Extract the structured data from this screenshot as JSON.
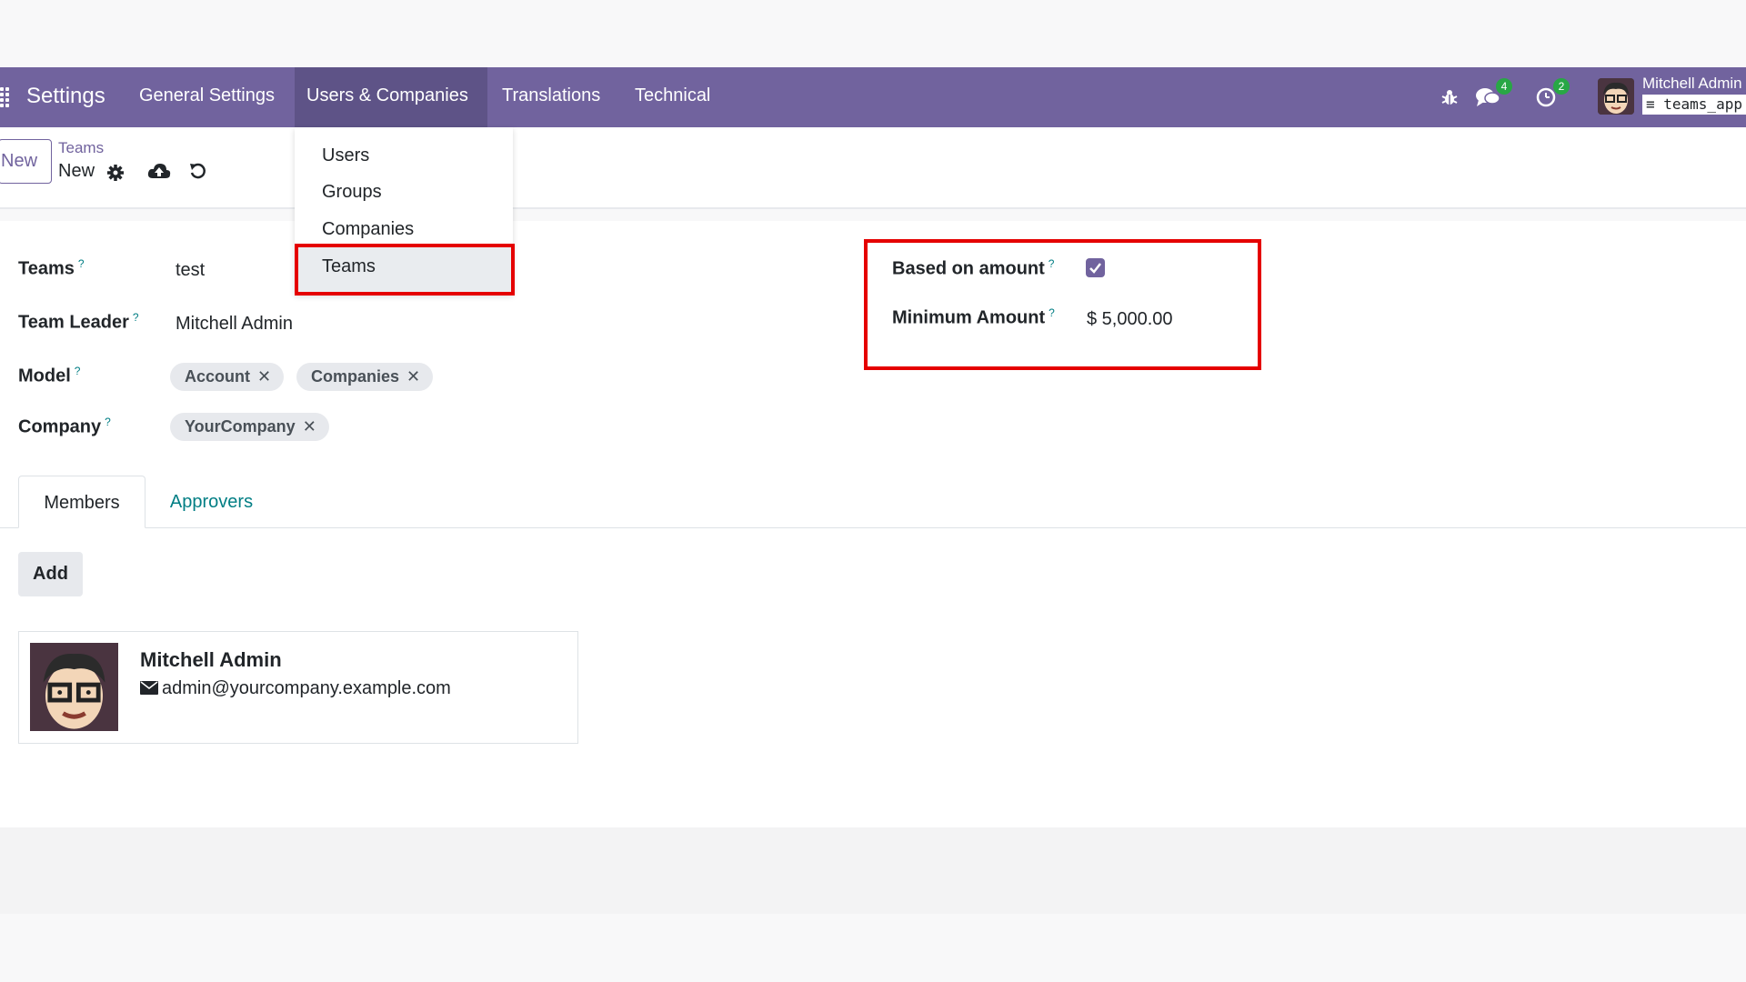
{
  "navbar": {
    "brand": "Settings",
    "menu": [
      "General Settings",
      "Users & Companies",
      "Translations",
      "Technical"
    ],
    "chat_badge": "4",
    "activity_badge": "2",
    "user_name": "Mitchell Admin",
    "database": "teams_app"
  },
  "control_panel": {
    "new_label": "New",
    "breadcrumb_parent": "Teams",
    "breadcrumb_current": "New"
  },
  "dropdown": {
    "items": [
      "Users",
      "Groups",
      "Companies",
      "Teams"
    ],
    "active": "Teams"
  },
  "form": {
    "teams_label": "Teams",
    "teams_value": "test",
    "leader_label": "Team Leader",
    "leader_value": "Mitchell Admin",
    "model_label": "Model",
    "model_tags": [
      "Account",
      "Companies"
    ],
    "company_label": "Company",
    "company_tags": [
      "YourCompany"
    ],
    "help_mark": "?",
    "based_on_amount_label": "Based on amount",
    "based_on_amount_checked": true,
    "minimum_amount_label": "Minimum Amount",
    "minimum_amount_value": "$ 5,000.00"
  },
  "tabs": {
    "members": "Members",
    "approvers": "Approvers",
    "active": "Members"
  },
  "members": {
    "add_label": "Add",
    "card": {
      "name": "Mitchell Admin",
      "email": "admin@yourcompany.example.com"
    }
  },
  "colors": {
    "brand": "#71639e",
    "highlight": "#e50000",
    "link": "#017e84"
  }
}
